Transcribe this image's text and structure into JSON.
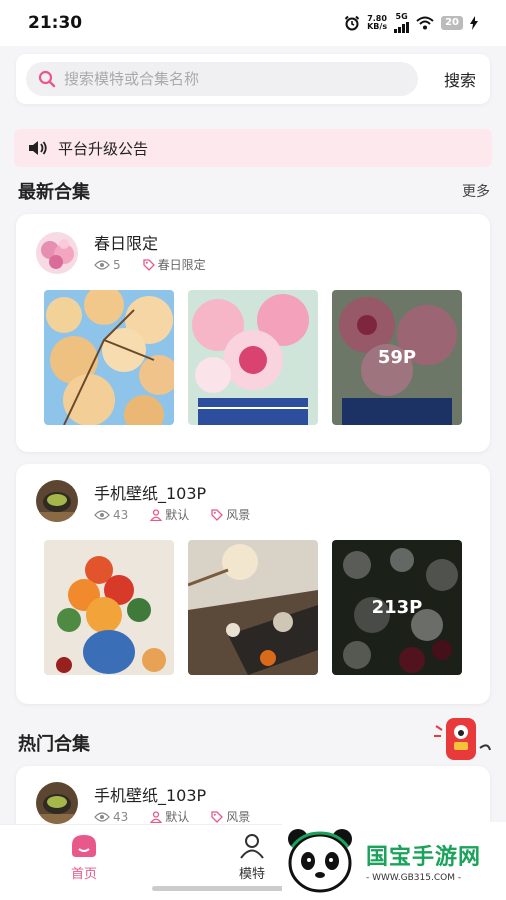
{
  "status": {
    "time": "21:30",
    "net_speed_top": "7.80",
    "net_speed_unit": "KB/s",
    "network": "5G",
    "battery": "20"
  },
  "search": {
    "placeholder": "搜索模特或合集名称",
    "button": "搜索"
  },
  "notice": {
    "text": "平台升级公告"
  },
  "latest": {
    "title": "最新合集",
    "more": "更多",
    "cards": [
      {
        "title": "春日限定",
        "views": "5",
        "tag": "春日限定",
        "count": "59P"
      },
      {
        "title": "手机壁纸_103P",
        "views": "43",
        "model": "默认",
        "tag": "风景",
        "count": "213P"
      }
    ]
  },
  "hot": {
    "title": "热门合集",
    "cards": [
      {
        "title": "手机壁纸_103P",
        "views": "43",
        "model": "默认",
        "tag": "风景"
      }
    ]
  },
  "tabs": [
    {
      "label": "首页",
      "active": true
    },
    {
      "label": "模特",
      "active": false
    }
  ],
  "watermark": {
    "title": "国宝手游网",
    "url": "- WWW.GB315.COM -"
  },
  "colors": {
    "accent": "#e8588a",
    "notice_bg": "#fde8ee",
    "brand_green": "#1aa35a"
  }
}
